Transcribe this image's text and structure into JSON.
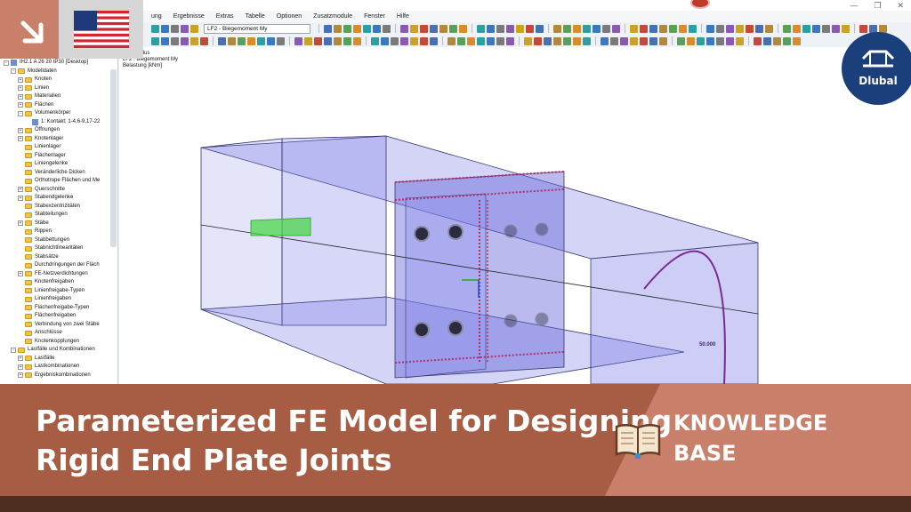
{
  "app": {
    "menu": [
      "ung",
      "Ergebnisse",
      "Extras",
      "Tabelle",
      "Optionen",
      "Zusatzmodule",
      "Fenster",
      "Hilfe"
    ],
    "load_case_select": "LF2 - Biegemoment My"
  },
  "navigator": {
    "items": [
      {
        "label": "IH2.1 A 26 20 tP30 [Desktop]",
        "level": 0,
        "exp": "-",
        "icon": "node"
      },
      {
        "label": "Modelldaten",
        "level": 1,
        "exp": "-",
        "icon": "folder"
      },
      {
        "label": "Knoten",
        "level": 2,
        "exp": "+",
        "icon": "folder"
      },
      {
        "label": "Linien",
        "level": 2,
        "exp": "+",
        "icon": "folder"
      },
      {
        "label": "Materialien",
        "level": 2,
        "exp": "+",
        "icon": "folder"
      },
      {
        "label": "Flächen",
        "level": 2,
        "exp": "+",
        "icon": "folder"
      },
      {
        "label": "Volumenkörper",
        "level": 2,
        "exp": "-",
        "icon": "folder"
      },
      {
        "label": "1: Kontakt; 1-4,6-9,17-22",
        "level": 3,
        "exp": "",
        "icon": "node"
      },
      {
        "label": "Öffnungen",
        "level": 2,
        "exp": "+",
        "icon": "folder"
      },
      {
        "label": "Knotenlager",
        "level": 2,
        "exp": "+",
        "icon": "folder"
      },
      {
        "label": "Linienlager",
        "level": 2,
        "exp": "",
        "icon": "folder"
      },
      {
        "label": "Flächenlager",
        "level": 2,
        "exp": "",
        "icon": "folder"
      },
      {
        "label": "Liniengelenke",
        "level": 2,
        "exp": "",
        "icon": "folder"
      },
      {
        "label": "Veränderliche Dicken",
        "level": 2,
        "exp": "",
        "icon": "folder"
      },
      {
        "label": "Orthotrope Flächen und Me",
        "level": 2,
        "exp": "",
        "icon": "folder"
      },
      {
        "label": "Querschnitte",
        "level": 2,
        "exp": "+",
        "icon": "folder"
      },
      {
        "label": "Stabendgelenke",
        "level": 2,
        "exp": "+",
        "icon": "folder"
      },
      {
        "label": "Stabexzentrizitäten",
        "level": 2,
        "exp": "",
        "icon": "folder"
      },
      {
        "label": "Stabteilungen",
        "level": 2,
        "exp": "",
        "icon": "folder"
      },
      {
        "label": "Stäbe",
        "level": 2,
        "exp": "+",
        "icon": "folder"
      },
      {
        "label": "Rippen",
        "level": 2,
        "exp": "",
        "icon": "folder"
      },
      {
        "label": "Stabbettungen",
        "level": 2,
        "exp": "",
        "icon": "folder"
      },
      {
        "label": "Stabnichtlinearitäten",
        "level": 2,
        "exp": "",
        "icon": "folder"
      },
      {
        "label": "Stabsätze",
        "level": 2,
        "exp": "",
        "icon": "folder"
      },
      {
        "label": "Durchdringungen der Fläch",
        "level": 2,
        "exp": "",
        "icon": "folder"
      },
      {
        "label": "FE-Netzverdichtungen",
        "level": 2,
        "exp": "+",
        "icon": "folder"
      },
      {
        "label": "Knotenfreigaben",
        "level": 2,
        "exp": "",
        "icon": "folder"
      },
      {
        "label": "Linienfreigabe-Typen",
        "level": 2,
        "exp": "",
        "icon": "folder"
      },
      {
        "label": "Linienfreigaben",
        "level": 2,
        "exp": "",
        "icon": "folder"
      },
      {
        "label": "Flächenfreigabe-Typen",
        "level": 2,
        "exp": "",
        "icon": "folder"
      },
      {
        "label": "Flächenfreigaben",
        "level": 2,
        "exp": "",
        "icon": "folder"
      },
      {
        "label": "Verbindung von zwei Stäbe",
        "level": 2,
        "exp": "",
        "icon": "folder"
      },
      {
        "label": "Anschlüsse",
        "level": 2,
        "exp": "",
        "icon": "folder"
      },
      {
        "label": "Knotenkopplungen",
        "level": 2,
        "exp": "",
        "icon": "folder"
      },
      {
        "label": "Lastfälle und Kombinationen",
        "level": 1,
        "exp": "-",
        "icon": "folder"
      },
      {
        "label": "Lastfälle",
        "level": 2,
        "exp": "+",
        "icon": "folder"
      },
      {
        "label": "Lastkombinationen",
        "level": 2,
        "exp": "+",
        "icon": "folder"
      },
      {
        "label": "Ergebniskombinationen",
        "level": 2,
        "exp": "+",
        "icon": "folder"
      }
    ]
  },
  "viewport": {
    "info_line1": "zeitsmodus",
    "info_line2": "LF2 : Biegemoment My",
    "info_line3": "Belastung [kNm]",
    "moment_value": "50.000"
  },
  "logo": {
    "text": "Dlubal"
  },
  "banner": {
    "title_line1": "Parameterized FE Model for Designing",
    "title_line2": "Rigid End Plate Joints",
    "kb_line1": "KNOWLEDGE",
    "kb_line2": "BASE"
  },
  "colors": {
    "banner_left": "#a65d43",
    "banner_right": "#c9806a",
    "bottom_bar": "#4d2e20",
    "logo_blue": "#1b3f7a",
    "model_fill": "#6f6fe6",
    "moment_arc": "#7a2a8f"
  }
}
